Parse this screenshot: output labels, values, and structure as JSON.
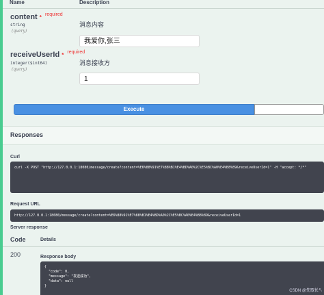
{
  "table_header": {
    "name": "Name",
    "description": "Description"
  },
  "params": [
    {
      "name": "content",
      "required_star": "*",
      "required_label": "required",
      "type": "string",
      "in": "(query)",
      "description": "消息内容",
      "value": "我爱你,张三"
    },
    {
      "name": "receiveUserId",
      "required_star": "*",
      "required_label": "required",
      "type": "integer($int64)",
      "in": "(query)",
      "description": "消息接收方",
      "value": "1"
    }
  ],
  "execute_label": "Execute",
  "responses": {
    "title": "Responses",
    "curl_label": "Curl",
    "curl_command": "curl -X POST \"http://127.0.0.1:18080/message/create?content=%E6%88%91%E7%88%B1%E4%BD%A0%2C%E5%BC%A0%E4%B8%89&receiveUserId=1\" -H \"accept: */*\"",
    "request_url_label": "Request URL",
    "request_url": "http://127.0.0.1:18080/message/create?content=%E6%88%91%E7%88%B1%E4%BD%A0%2C%E5%BC%A0%E4%B8%89&receiveUserId=1",
    "server_response_label": "Server response",
    "code_header": "Code",
    "details_header": "Details",
    "status_code": "200",
    "response_body_label": "Response body",
    "response_body": "{\n  \"code\": 0,\n  \"message\": \"发送成功\",\n  \"data\": null\n}"
  },
  "watermark": "CSDN @先取长↖"
}
